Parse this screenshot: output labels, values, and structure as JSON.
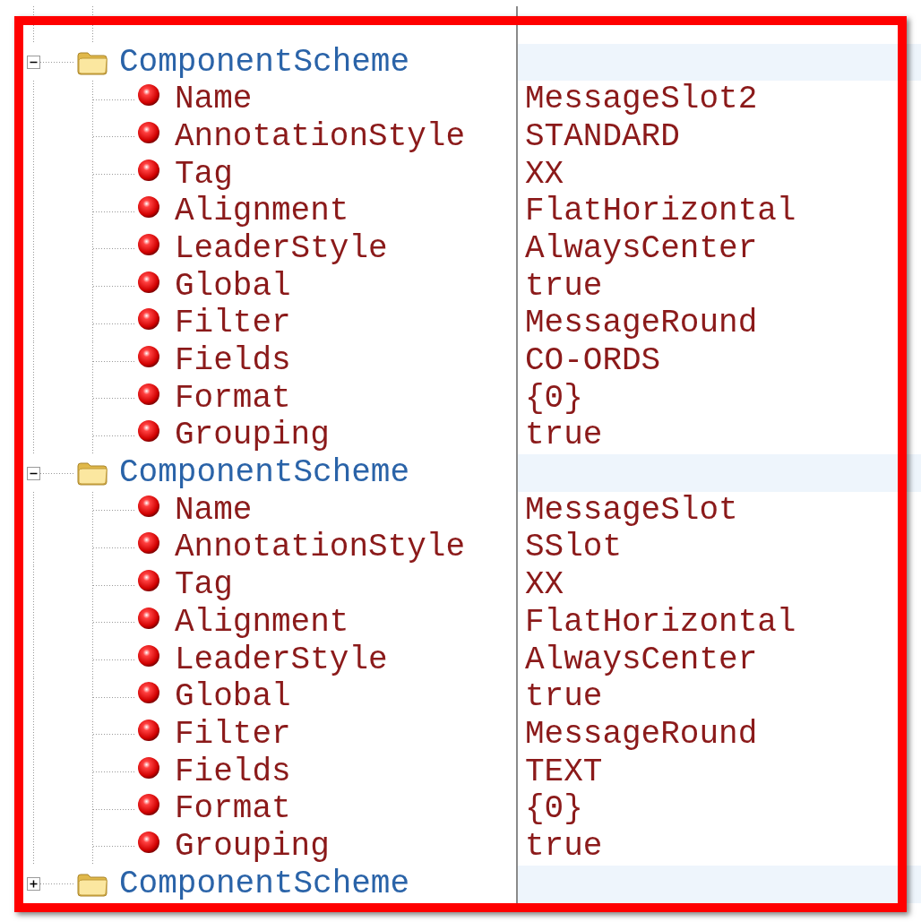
{
  "groups": [
    {
      "label": "ComponentScheme",
      "expanded": true,
      "properties": [
        {
          "name": "Name",
          "value": "MessageSlot2"
        },
        {
          "name": "AnnotationStyle",
          "value": "STANDARD"
        },
        {
          "name": "Tag",
          "value": "XX"
        },
        {
          "name": "Alignment",
          "value": "FlatHorizontal"
        },
        {
          "name": "LeaderStyle",
          "value": "AlwaysCenter"
        },
        {
          "name": "Global",
          "value": "true"
        },
        {
          "name": "Filter",
          "value": "MessageRound"
        },
        {
          "name": "Fields",
          "value": "CO-ORDS"
        },
        {
          "name": "Format",
          "value": "{0}"
        },
        {
          "name": "Grouping",
          "value": "true"
        }
      ]
    },
    {
      "label": "ComponentScheme",
      "expanded": true,
      "properties": [
        {
          "name": "Name",
          "value": "MessageSlot"
        },
        {
          "name": "AnnotationStyle",
          "value": "SSlot"
        },
        {
          "name": "Tag",
          "value": "XX"
        },
        {
          "name": "Alignment",
          "value": "FlatHorizontal"
        },
        {
          "name": "LeaderStyle",
          "value": "AlwaysCenter"
        },
        {
          "name": "Global",
          "value": "true"
        },
        {
          "name": "Filter",
          "value": "MessageRound"
        },
        {
          "name": "Fields",
          "value": "TEXT"
        },
        {
          "name": "Format",
          "value": "{0}"
        },
        {
          "name": "Grouping",
          "value": "true"
        }
      ]
    },
    {
      "label": "ComponentScheme",
      "expanded": false
    }
  ]
}
